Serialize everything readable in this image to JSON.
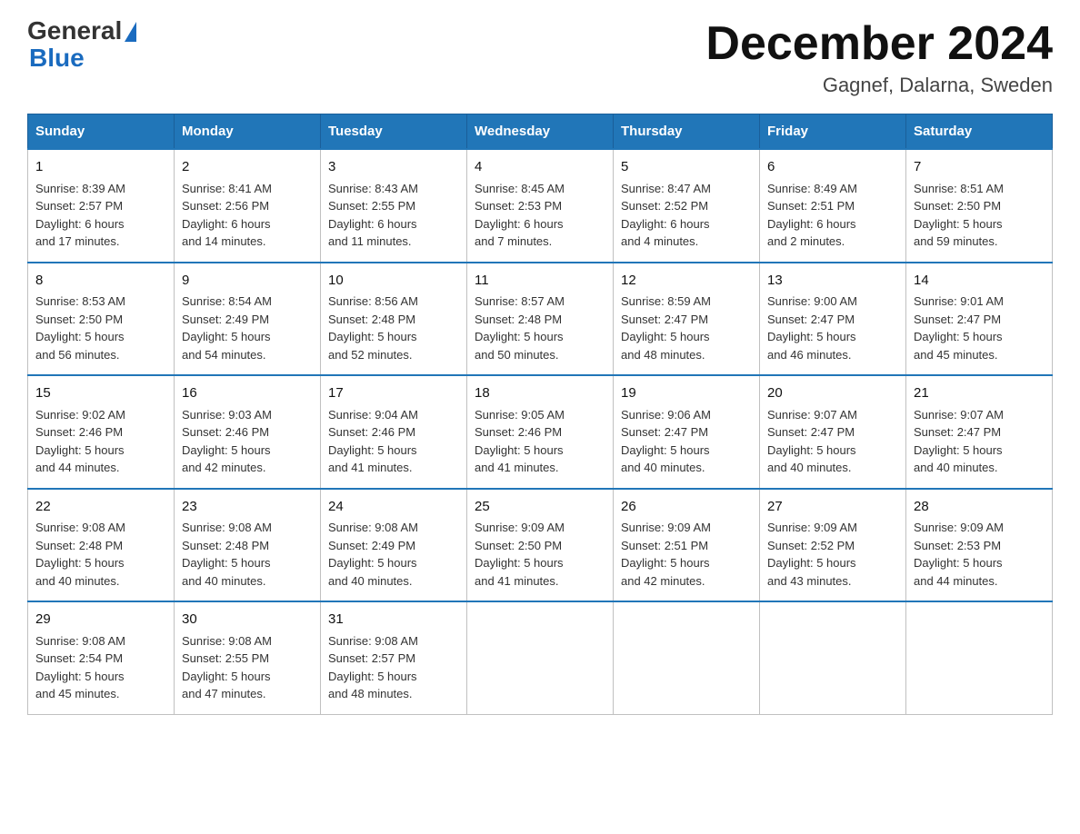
{
  "logo": {
    "general": "General",
    "blue": "Blue",
    "triangle": "▲"
  },
  "title": {
    "month_year": "December 2024",
    "location": "Gagnef, Dalarna, Sweden"
  },
  "headers": [
    "Sunday",
    "Monday",
    "Tuesday",
    "Wednesday",
    "Thursday",
    "Friday",
    "Saturday"
  ],
  "weeks": [
    [
      {
        "day": "1",
        "info": "Sunrise: 8:39 AM\nSunset: 2:57 PM\nDaylight: 6 hours\nand 17 minutes."
      },
      {
        "day": "2",
        "info": "Sunrise: 8:41 AM\nSunset: 2:56 PM\nDaylight: 6 hours\nand 14 minutes."
      },
      {
        "day": "3",
        "info": "Sunrise: 8:43 AM\nSunset: 2:55 PM\nDaylight: 6 hours\nand 11 minutes."
      },
      {
        "day": "4",
        "info": "Sunrise: 8:45 AM\nSunset: 2:53 PM\nDaylight: 6 hours\nand 7 minutes."
      },
      {
        "day": "5",
        "info": "Sunrise: 8:47 AM\nSunset: 2:52 PM\nDaylight: 6 hours\nand 4 minutes."
      },
      {
        "day": "6",
        "info": "Sunrise: 8:49 AM\nSunset: 2:51 PM\nDaylight: 6 hours\nand 2 minutes."
      },
      {
        "day": "7",
        "info": "Sunrise: 8:51 AM\nSunset: 2:50 PM\nDaylight: 5 hours\nand 59 minutes."
      }
    ],
    [
      {
        "day": "8",
        "info": "Sunrise: 8:53 AM\nSunset: 2:50 PM\nDaylight: 5 hours\nand 56 minutes."
      },
      {
        "day": "9",
        "info": "Sunrise: 8:54 AM\nSunset: 2:49 PM\nDaylight: 5 hours\nand 54 minutes."
      },
      {
        "day": "10",
        "info": "Sunrise: 8:56 AM\nSunset: 2:48 PM\nDaylight: 5 hours\nand 52 minutes."
      },
      {
        "day": "11",
        "info": "Sunrise: 8:57 AM\nSunset: 2:48 PM\nDaylight: 5 hours\nand 50 minutes."
      },
      {
        "day": "12",
        "info": "Sunrise: 8:59 AM\nSunset: 2:47 PM\nDaylight: 5 hours\nand 48 minutes."
      },
      {
        "day": "13",
        "info": "Sunrise: 9:00 AM\nSunset: 2:47 PM\nDaylight: 5 hours\nand 46 minutes."
      },
      {
        "day": "14",
        "info": "Sunrise: 9:01 AM\nSunset: 2:47 PM\nDaylight: 5 hours\nand 45 minutes."
      }
    ],
    [
      {
        "day": "15",
        "info": "Sunrise: 9:02 AM\nSunset: 2:46 PM\nDaylight: 5 hours\nand 44 minutes."
      },
      {
        "day": "16",
        "info": "Sunrise: 9:03 AM\nSunset: 2:46 PM\nDaylight: 5 hours\nand 42 minutes."
      },
      {
        "day": "17",
        "info": "Sunrise: 9:04 AM\nSunset: 2:46 PM\nDaylight: 5 hours\nand 41 minutes."
      },
      {
        "day": "18",
        "info": "Sunrise: 9:05 AM\nSunset: 2:46 PM\nDaylight: 5 hours\nand 41 minutes."
      },
      {
        "day": "19",
        "info": "Sunrise: 9:06 AM\nSunset: 2:47 PM\nDaylight: 5 hours\nand 40 minutes."
      },
      {
        "day": "20",
        "info": "Sunrise: 9:07 AM\nSunset: 2:47 PM\nDaylight: 5 hours\nand 40 minutes."
      },
      {
        "day": "21",
        "info": "Sunrise: 9:07 AM\nSunset: 2:47 PM\nDaylight: 5 hours\nand 40 minutes."
      }
    ],
    [
      {
        "day": "22",
        "info": "Sunrise: 9:08 AM\nSunset: 2:48 PM\nDaylight: 5 hours\nand 40 minutes."
      },
      {
        "day": "23",
        "info": "Sunrise: 9:08 AM\nSunset: 2:48 PM\nDaylight: 5 hours\nand 40 minutes."
      },
      {
        "day": "24",
        "info": "Sunrise: 9:08 AM\nSunset: 2:49 PM\nDaylight: 5 hours\nand 40 minutes."
      },
      {
        "day": "25",
        "info": "Sunrise: 9:09 AM\nSunset: 2:50 PM\nDaylight: 5 hours\nand 41 minutes."
      },
      {
        "day": "26",
        "info": "Sunrise: 9:09 AM\nSunset: 2:51 PM\nDaylight: 5 hours\nand 42 minutes."
      },
      {
        "day": "27",
        "info": "Sunrise: 9:09 AM\nSunset: 2:52 PM\nDaylight: 5 hours\nand 43 minutes."
      },
      {
        "day": "28",
        "info": "Sunrise: 9:09 AM\nSunset: 2:53 PM\nDaylight: 5 hours\nand 44 minutes."
      }
    ],
    [
      {
        "day": "29",
        "info": "Sunrise: 9:08 AM\nSunset: 2:54 PM\nDaylight: 5 hours\nand 45 minutes."
      },
      {
        "day": "30",
        "info": "Sunrise: 9:08 AM\nSunset: 2:55 PM\nDaylight: 5 hours\nand 47 minutes."
      },
      {
        "day": "31",
        "info": "Sunrise: 9:08 AM\nSunset: 2:57 PM\nDaylight: 5 hours\nand 48 minutes."
      },
      null,
      null,
      null,
      null
    ]
  ]
}
